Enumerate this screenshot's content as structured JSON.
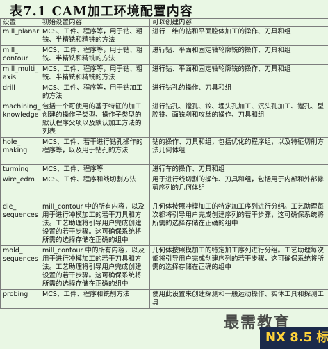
{
  "title": "表7.1 CAM加工环境配置内容",
  "table": {
    "headers": [
      "设置",
      "初始设置内容",
      "可以创建内容"
    ],
    "rows": [
      {
        "setting": "mill_planar",
        "initial": "MCS、工件、程序等，用于钻、粗铣、半精铣和精铣的方法",
        "create": "进行二维的钻和平面腔体加工的操作、刀具和组"
      },
      {
        "setting": "mill_ contour",
        "initial": "MCS、工件、程序等，用于钻、粗铣、半精铣和精铣的方法",
        "create": "进行钻、平面和固定轴轮廓铣的操作、刀具和组"
      },
      {
        "setting": "mill_multi_ axis",
        "initial": "MCS、工件、程序等，用于钻、粗铣、半精铣和精铣的方法",
        "create": "进行钻、平面和固定轴轮廓铣的操作、刀具和组"
      },
      {
        "setting": "drill",
        "initial": "MCS、工件、程序等，用于钻加工的方法",
        "create": "进行钻孔的操作、刀具和组"
      },
      {
        "setting": "machining_ knowledge",
        "initial": "包括一个可使用的基于特征的加工创建的操作子类型、操作子类型的默认程序父项以及默认加工方法的列表",
        "create": "进行钻孔、镗孔、铰、埋头孔加工、沉头孔加工、镗孔、型腔铣、面铣削和攻丝的操作、刀具和组"
      },
      {
        "setting": "hole_ making",
        "initial": "MCS、工件、若干进行钻孔操作的程序等，以及用于钻孔的方法",
        "create": "钻的操作、刀具和组，包括优化的程序组，以及特征切削方法几何体组"
      },
      {
        "setting": "turming",
        "initial": "MCS、工件、程序等",
        "create": "进行车的操作、刀具和组"
      },
      {
        "setting": "wire_edm",
        "initial": "MCS、工件、程序和线切割方法",
        "create": "用于进行线切割的操作、刀具和组，包括用于内部和外部修剪序列的几何体组"
      },
      {
        "setting": "die_ sequences",
        "initial": "mill_contour 中的所有内容，以及用于进行冲模加工的若干刀具和方法。工艺助理将引导用户完成创建设置的若干步骤。这可确保系统将所需的选择存储在正确的组中",
        "create": "几何体按照冲模加工的特定加工序列进行分组。工艺助理每次都将引导用户完成创建序列的若干步骤，这可确保系统将 所需的选择存储在正确的组中"
      },
      {
        "setting": "mold_ sequences",
        "initial": "mill_contour 中的所有内容，以及用于进行冲模加工的若干刀具和方法。工艺助理将引导用户完成创建设置的若干步骤。这可确保系统将所需的选择存储在正确的组中",
        "create": "几何体按照模加工的特定加工序列进行分组。工艺助理每次都将引导用户完成创建序列的若干步骤，这可确保系统将所需的选择存储在正确的组中"
      },
      {
        "setting": "probing",
        "initial": "MCS、工件、程序和铣削方法",
        "create": "使用此设置来创建探测和一般运动操作、实体工具和探测工具"
      }
    ]
  },
  "watermark": {
    "brand": "最需教育",
    "badge": "NX 8.5 标"
  }
}
